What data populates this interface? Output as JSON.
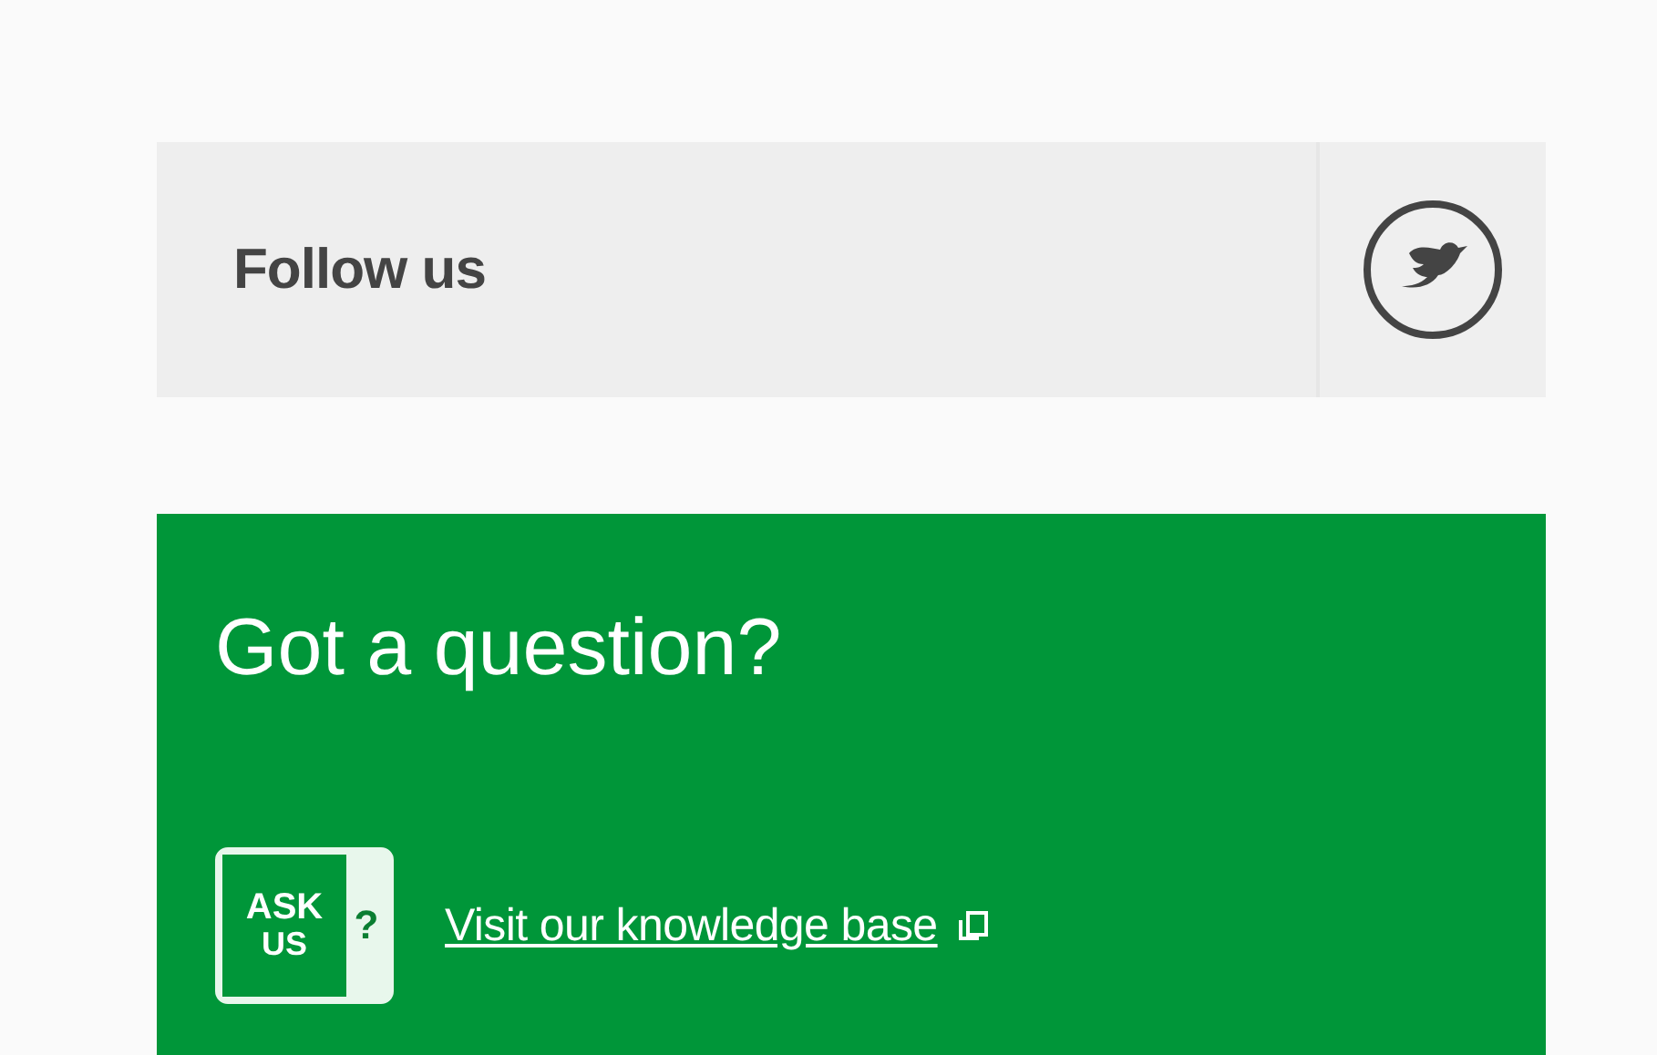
{
  "follow": {
    "label": "Follow us"
  },
  "question": {
    "title": "Got a question?",
    "badge": {
      "top": "ASK",
      "bottom": "US",
      "mark": "?"
    },
    "link": "Visit our knowledge base"
  }
}
